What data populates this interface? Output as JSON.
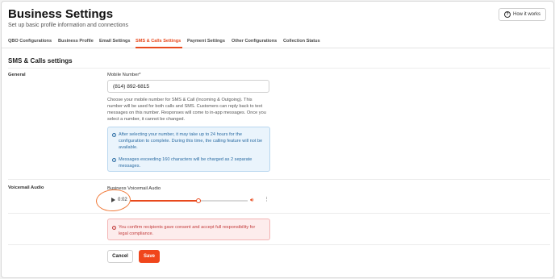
{
  "header": {
    "title": "Business Settings",
    "subtitle": "Set up basic profile information and connections",
    "help_button": "How it works"
  },
  "tabs": [
    {
      "label": "QBO Configurations",
      "active": false
    },
    {
      "label": "Business Profile",
      "active": false
    },
    {
      "label": "Email Settings",
      "active": false
    },
    {
      "label": "SMS & Calls Settings",
      "active": true
    },
    {
      "label": "Payment Settings",
      "active": false
    },
    {
      "label": "Other Configurations",
      "active": false
    },
    {
      "label": "Collection Status",
      "active": false
    }
  ],
  "section_title": "SMS & Calls settings",
  "general": {
    "label": "General",
    "mobile_label": "Mobile Number*",
    "mobile_value": "(814) 892-6815",
    "help_text": "Choose your mobile number for SMS & Call (Incoming & Outgoing). This number will be used for both calls and SMS. Customers can reply back to text messages on this number. Responses will come to in-app messages. Once you select a number, it cannot be changed.",
    "info_1": "After selecting your number, it may take up to 24 hours for the configuration to complete. During this time, the calling feature will not be available.",
    "info_2": "Messages exceeding 160 characters will be charged as 2 separate messages."
  },
  "voicemail": {
    "label": "Voicemail Audio",
    "audio_label": "Business Voicemail Audio",
    "time": "0:02",
    "progress": 0.58,
    "icons": {
      "play": "play-icon",
      "volume": "volume-icon",
      "more": "more-vertical-icon"
    }
  },
  "consent_text": "You confirm recipients gave consent and accept full responsibility for legal compliance.",
  "actions": {
    "cancel": "Cancel",
    "save": "Save"
  },
  "colors": {
    "accent": "#e8491d",
    "info": "#2b6ca3",
    "error": "#c23a3a"
  }
}
